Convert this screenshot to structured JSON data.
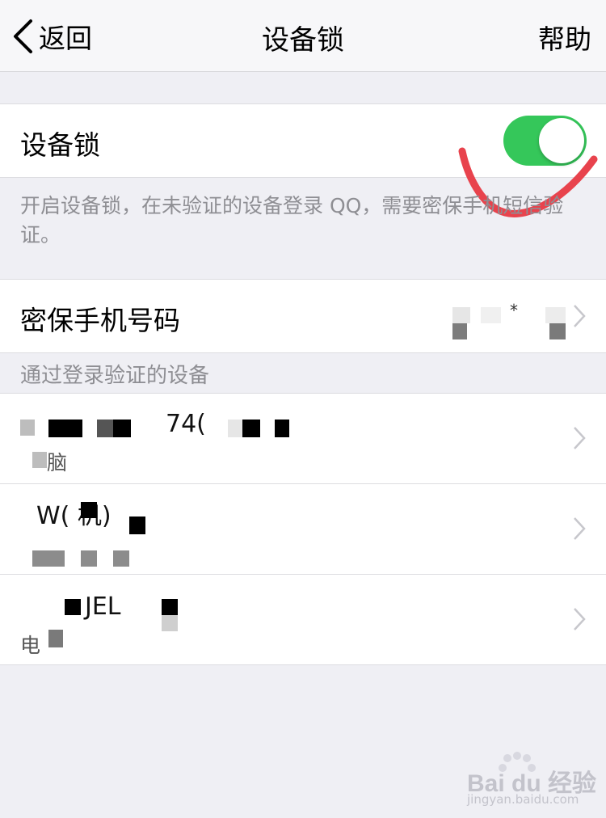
{
  "nav": {
    "back_label": "返回",
    "title": "设备锁",
    "help_label": "帮助"
  },
  "device_lock": {
    "label": "设备锁",
    "enabled": true,
    "accent": "#35c75a"
  },
  "description": "开启设备锁，在未验证的设备登录 QQ，需要密保手机短信验证。",
  "phone": {
    "label": "密保手机号码",
    "value_partial": "*"
  },
  "devices_header": "通过登录验证的设备",
  "devices": [
    {
      "name_partial": "74(",
      "type_partial": "脑"
    },
    {
      "name_partial": "W( 机)",
      "type_partial": ""
    },
    {
      "name_partial": "JEL",
      "type_partial": "电"
    }
  ],
  "watermark": {
    "text": "Bai du 经验",
    "sub": "jingyan.baidu.com"
  }
}
